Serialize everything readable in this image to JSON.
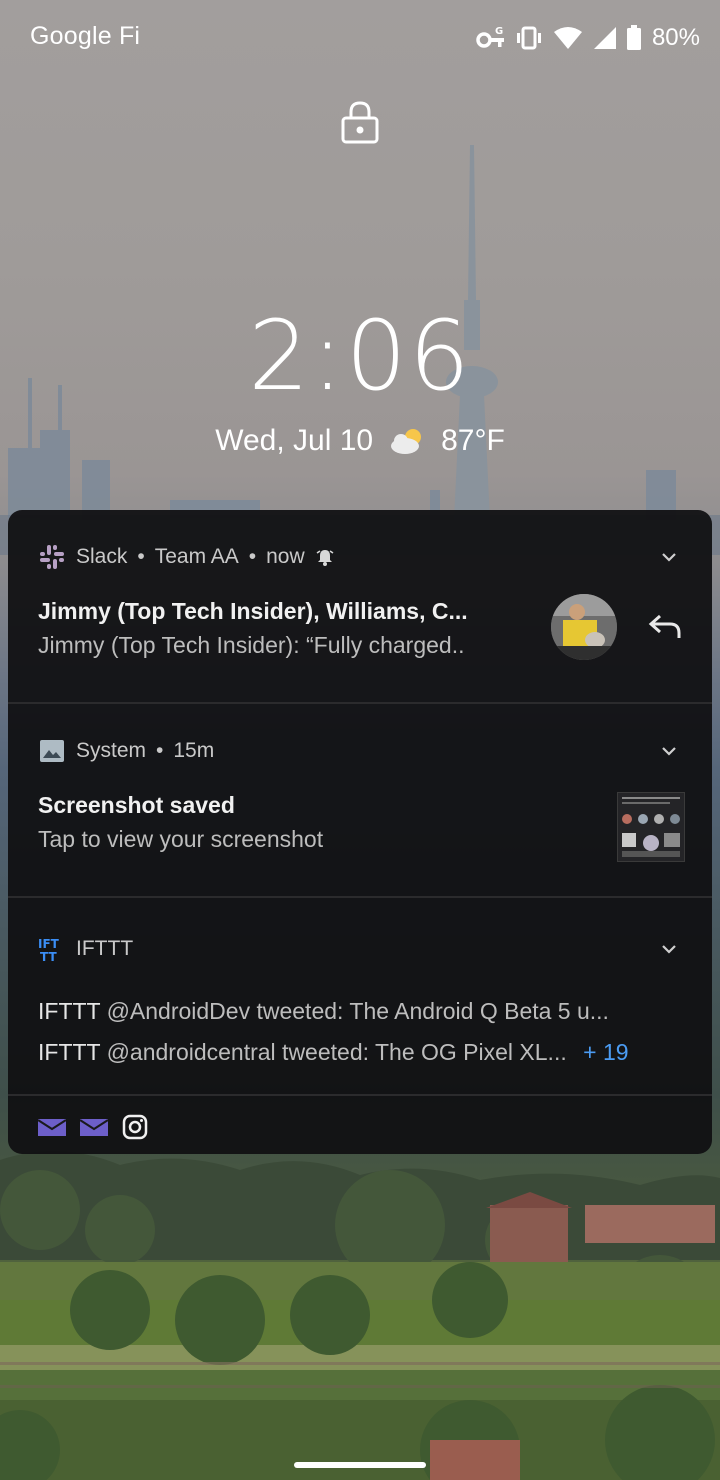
{
  "status_bar": {
    "carrier": "Google Fi",
    "battery_percent": "80%",
    "icons": [
      "vpn-key-icon",
      "vibrate-icon",
      "wifi-icon",
      "cell-signal-icon",
      "battery-icon"
    ]
  },
  "lockscreen": {
    "time": "2:06",
    "date": "Wed, Jul 10",
    "temperature": "87°F",
    "weather_icon": "partly-cloudy-icon"
  },
  "notifications": [
    {
      "app": "Slack",
      "meta": "Team AA",
      "time": "now",
      "title": "Jimmy (Top Tech Insider), Williams, C...",
      "body": "Jimmy (Top Tech Insider): “Fully charged..",
      "icon": "slack-icon",
      "accent": "#b7a0c4"
    },
    {
      "app": "System",
      "time": "15m",
      "title": "Screenshot saved",
      "body": "Tap to view your screenshot",
      "icon": "image-icon"
    },
    {
      "app": "IFTTT",
      "icon": "ifttt-icon",
      "accent": "#3b8ef5",
      "lines": [
        {
          "sender": "IFTTT",
          "text": "@AndroidDev tweeted: The Android Q Beta 5 u..."
        },
        {
          "sender": "IFTTT",
          "text": "@androidcentral tweeted: The OG Pixel XL..."
        }
      ],
      "more_count": "+ 19"
    }
  ],
  "overflow_icons": [
    "mail-icon",
    "mail-icon",
    "instagram-icon"
  ],
  "colors": {
    "panel_bg": "#101012",
    "link_blue": "#4b9cf3",
    "mail_purple": "#6d5fc9"
  }
}
